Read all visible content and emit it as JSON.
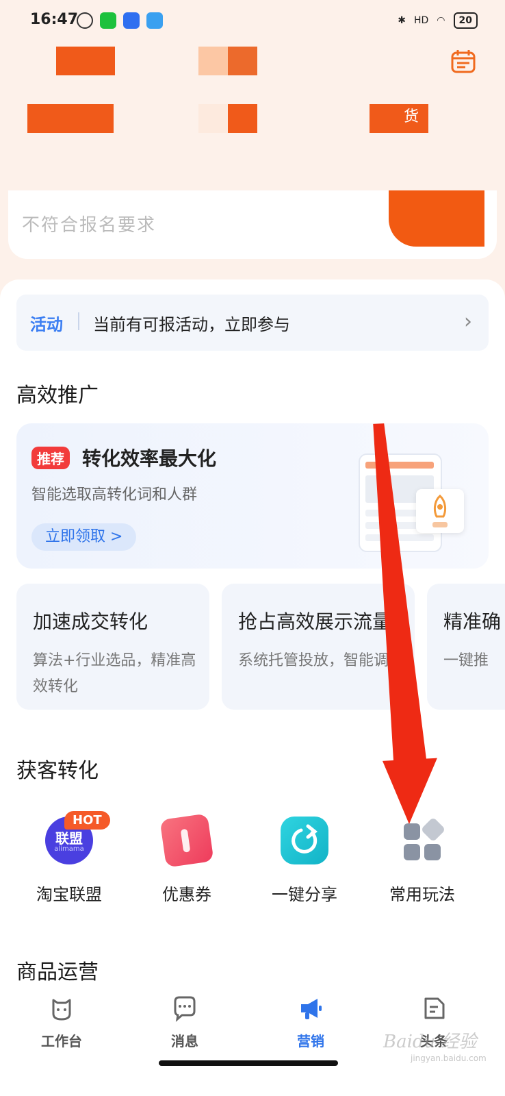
{
  "status_bar": {
    "time": "16:47",
    "network": "HD",
    "battery": "20"
  },
  "header": {
    "blurred_text_hint": "货"
  },
  "search": {
    "text": "不符合报名要求"
  },
  "activity": {
    "tag": "活动",
    "text": "当前有可报活动，立即参与",
    "chevron": "›"
  },
  "efficient_promo": {
    "title": "高效推广",
    "banner": {
      "badge": "推荐",
      "title": "转化效率最大化",
      "subtitle": "智能选取高转化词和人群",
      "button": "立即领取 >"
    },
    "cards": [
      {
        "title": "加速成交转化",
        "desc": "算法+行业选品，精准高效转化"
      },
      {
        "title": "抢占高效展示流量",
        "desc": "系统托管投放，智能调优"
      },
      {
        "title": "精准确",
        "desc": "一键推"
      }
    ]
  },
  "acquire": {
    "title": "获客转化",
    "hot_badge": "HOT",
    "tools": [
      {
        "label": "淘宝联盟",
        "icon": "alliance-logo-icon",
        "icon_text": "联盟",
        "icon_sub": "alimama",
        "color": "#4a3fe0"
      },
      {
        "label": "优惠券",
        "icon": "coupon-icon",
        "color": "#f0466a"
      },
      {
        "label": "一键分享",
        "icon": "share-icon",
        "color": "#18c1d0"
      },
      {
        "label": "常用玩法",
        "icon": "grid-apps-icon",
        "color": "#8a93a3"
      }
    ]
  },
  "product_ops": {
    "title": "商品运营"
  },
  "bottom_nav": [
    {
      "label": "工作台",
      "icon": "workbench-icon",
      "active": false
    },
    {
      "label": "消息",
      "icon": "message-icon",
      "active": false
    },
    {
      "label": "营销",
      "icon": "marketing-megaphone-icon",
      "active": true
    },
    {
      "label": "头条",
      "icon": "headlines-icon",
      "active": false
    }
  ],
  "watermark": {
    "text": "Baidu 经验",
    "sub": "jingyan.baidu.com"
  },
  "colors": {
    "accent_orange": "#f05a1a",
    "accent_blue": "#2f74ea",
    "annotation_red": "#ee2a14"
  }
}
